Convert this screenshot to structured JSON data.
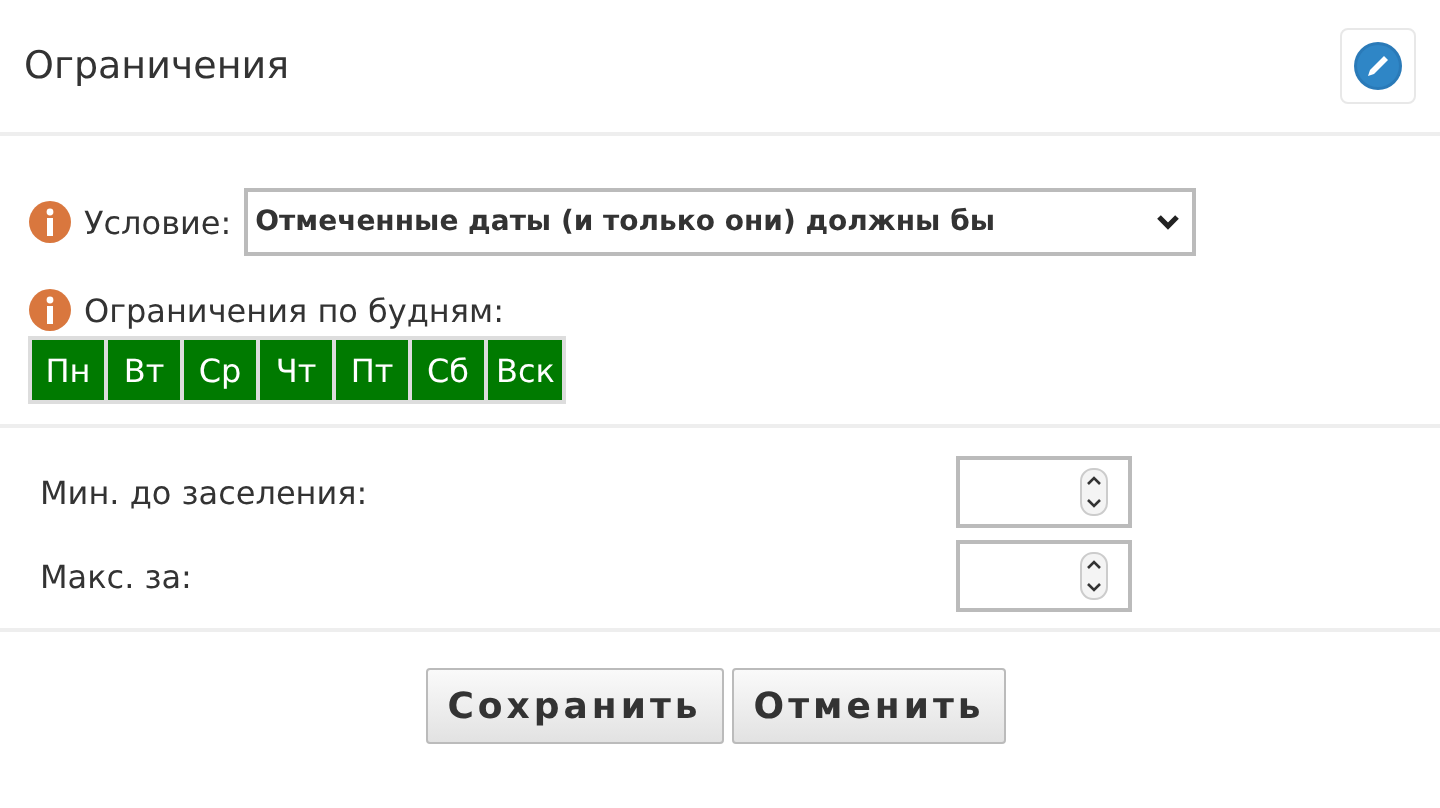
{
  "header": {
    "title": "Ограничения"
  },
  "condition": {
    "label": "Условие:",
    "value": "Отмеченные даты (и только они) должны бы"
  },
  "weekdays": {
    "label": "Ограничения по будням:",
    "days": [
      {
        "label": "Пн",
        "selected": true
      },
      {
        "label": "Вт",
        "selected": true
      },
      {
        "label": "Ср",
        "selected": true
      },
      {
        "label": "Чт",
        "selected": true
      },
      {
        "label": "Пт",
        "selected": true
      },
      {
        "label": "Сб",
        "selected": true
      },
      {
        "label": "Вск",
        "selected": true
      }
    ]
  },
  "fields": [
    {
      "label": "Мин. до заселения:"
    },
    {
      "label": "Макс. за:"
    }
  ],
  "buttons": [
    "Сохранить",
    "Отменить"
  ]
}
